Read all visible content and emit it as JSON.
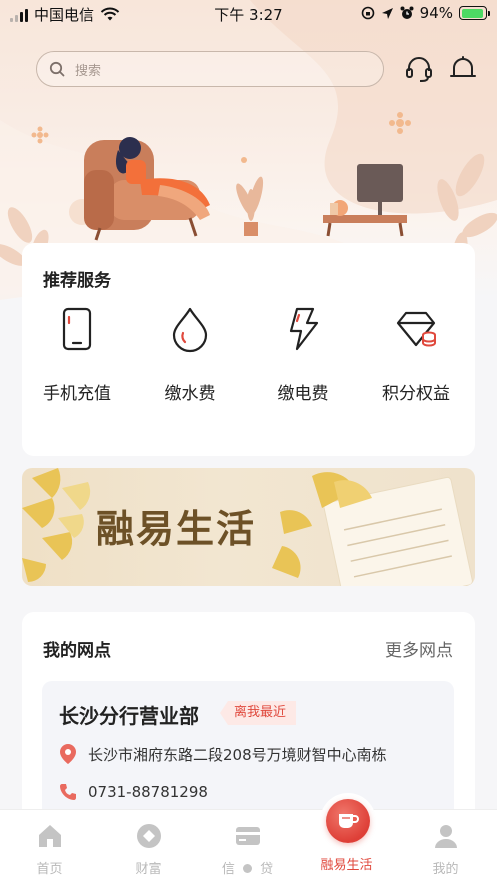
{
  "status_bar": {
    "carrier": "中国电信",
    "time": "下午 3:27",
    "battery": "94%"
  },
  "search": {
    "placeholder": "搜索"
  },
  "header_icons": [
    "headset-icon",
    "bell-icon"
  ],
  "recommended": {
    "title": "推荐服务",
    "items": [
      {
        "label": "手机充值",
        "icon": "phone-icon"
      },
      {
        "label": "缴水费",
        "icon": "water-drop-icon"
      },
      {
        "label": "缴电费",
        "icon": "lightning-icon"
      },
      {
        "label": "积分权益",
        "icon": "diamond-coins-icon"
      }
    ]
  },
  "banner": {
    "title": "融易生活"
  },
  "outlets": {
    "title": "我的网点",
    "more": "更多网点",
    "branch": {
      "name": "长沙分行营业部",
      "badge": "离我最近",
      "address": "长沙市湘府东路二段208号万境财智中心南栋",
      "phone": "0731-88781298"
    }
  },
  "tabs": [
    {
      "label": "首页",
      "icon": "home-icon"
    },
    {
      "label": "财富",
      "icon": "wealth-icon"
    },
    {
      "label": "信",
      "label2": "贷",
      "icon": "card-icon"
    },
    {
      "label": "融易生活",
      "icon": "cup-icon",
      "active": true
    },
    {
      "label": "我的",
      "icon": "profile-icon"
    }
  ],
  "colors": {
    "accent": "#e0493d",
    "banner_text": "#6d5127",
    "hero_bg": "#f8e6da"
  }
}
